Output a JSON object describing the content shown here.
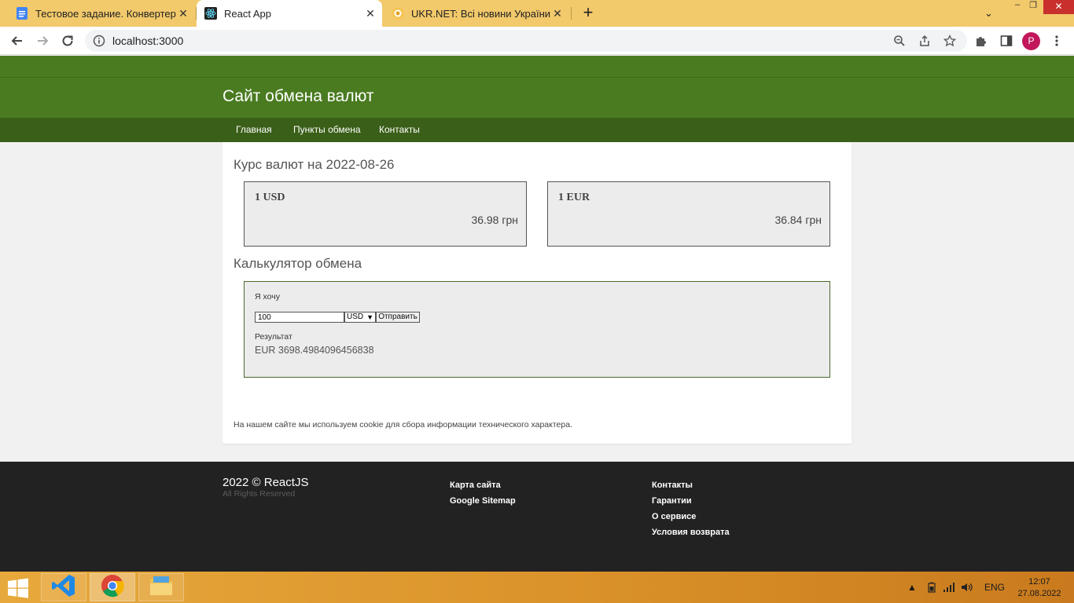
{
  "browser": {
    "tabs": [
      {
        "title": "Тестовое задание. Конвертер ва",
        "icon": "google-docs-icon",
        "active": false
      },
      {
        "title": "React App",
        "icon": "react-icon",
        "active": true
      },
      {
        "title": "UKR.NET: Всі новини України, ос",
        "icon": "ukrnet-icon",
        "active": false
      }
    ],
    "address": "localhost:3000",
    "profile_initial": "P"
  },
  "site": {
    "title": "Сайт обмена валют",
    "nav": [
      "Главная",
      "Пункты обмена",
      "Контакты"
    ],
    "rates_heading": "Курс валют на 2022-08-26",
    "rates": [
      {
        "currency": "1 USD",
        "value": "36.98 грн"
      },
      {
        "currency": "1 EUR",
        "value": "36.84 грн"
      }
    ],
    "calc_heading": "Калькулятор обмена",
    "calc": {
      "want_label": "Я хочу",
      "amount": "100",
      "currency": "USD",
      "submit_label": "Отправить",
      "result_label": "Результат",
      "result_value": "EUR 3698.4984096456838"
    },
    "cookie_notice": "На нашем сайте мы используем cookie для сбора информации технического характера."
  },
  "footer": {
    "copyright": "2022 © ReactJS",
    "rights": "All Rights Reserved",
    "col1": [
      "Карта сайта",
      "Google Sitemap"
    ],
    "col2": [
      "Контакты",
      "Гарантии",
      "О сервисе",
      "Условия возврата"
    ]
  },
  "taskbar": {
    "language": "ENG",
    "time": "12:07",
    "date": "27.08.2022"
  },
  "colors": {
    "header_green": "#4a7b20",
    "nav_green": "#3a5f18",
    "footer_bg": "#222222",
    "tabbar": "#f2c96b"
  }
}
